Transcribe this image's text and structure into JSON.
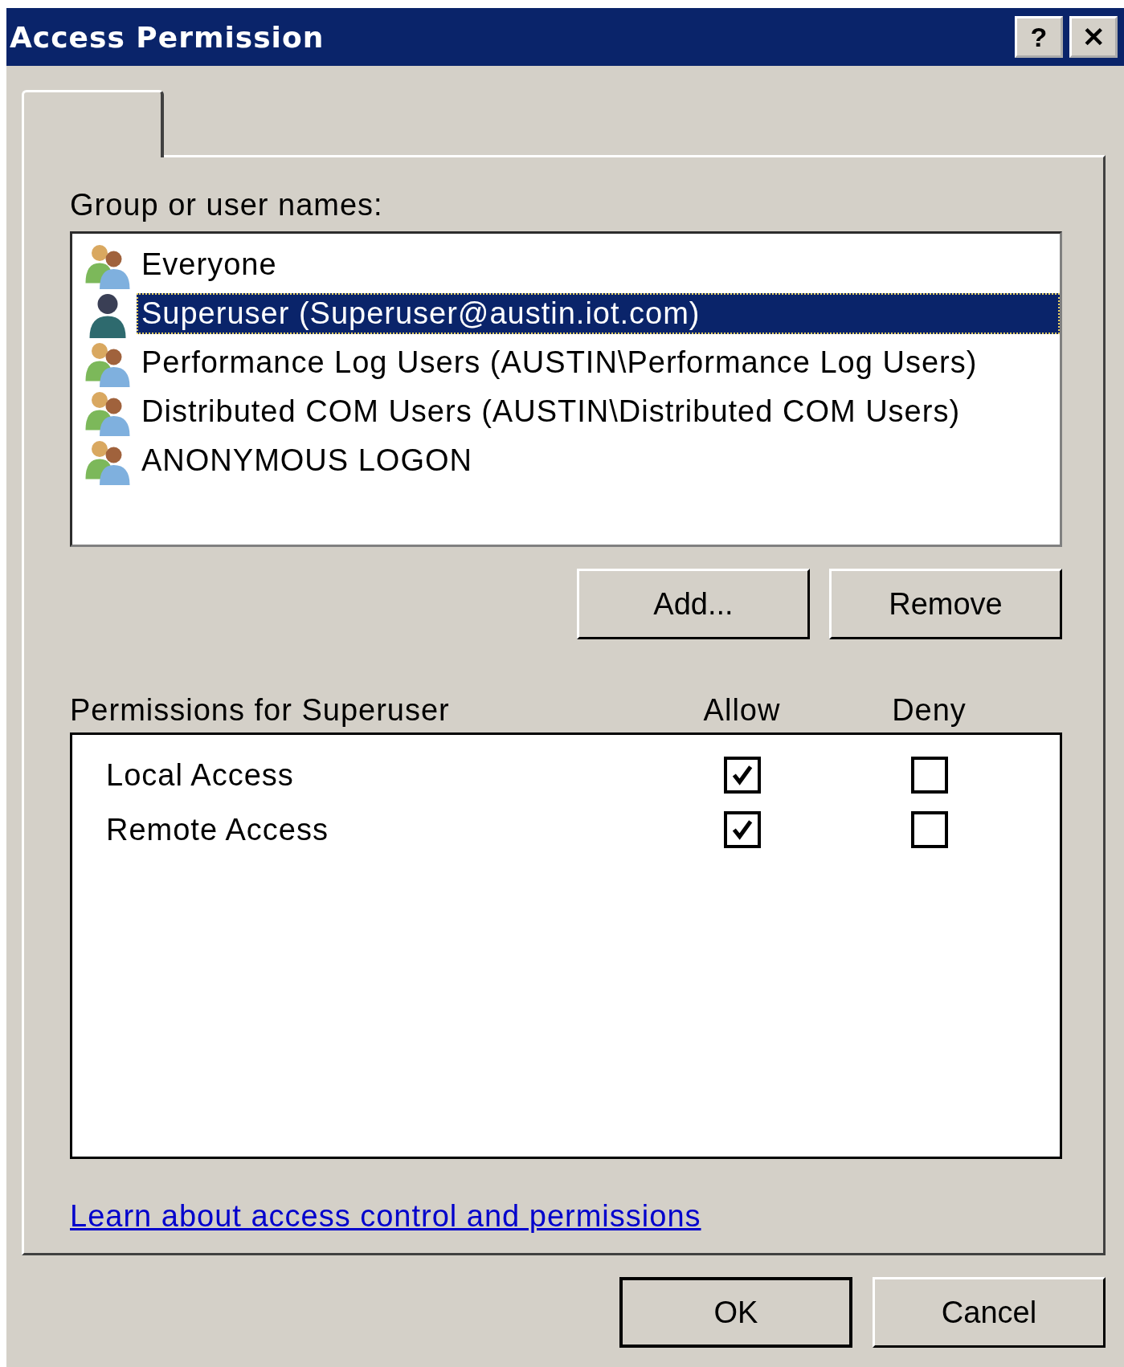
{
  "window": {
    "title": "Access Permission",
    "title_buttons": [
      "?",
      "✕"
    ]
  },
  "group_label": "Group or user names:",
  "users": [
    {
      "name": "Everyone",
      "kind": "group",
      "selected": false
    },
    {
      "name": "Superuser (Superuser@austin.iot.com)",
      "kind": "user",
      "selected": true
    },
    {
      "name": "Performance Log Users (AUSTIN\\Performance Log Users)",
      "kind": "group",
      "selected": false
    },
    {
      "name": "Distributed COM Users (AUSTIN\\Distributed COM Users)",
      "kind": "group",
      "selected": false
    },
    {
      "name": "ANONYMOUS LOGON",
      "kind": "group",
      "selected": false
    }
  ],
  "user_buttons": [
    "Add...",
    "Remove"
  ],
  "permissions_label": "Permissions for Superuser",
  "columns": [
    "Allow",
    "Deny"
  ],
  "permissions": [
    {
      "name": "Local Access",
      "allow": true,
      "deny": false
    },
    {
      "name": "Remote Access",
      "allow": true,
      "deny": false
    }
  ],
  "link": "Learn about access control and permissions",
  "buttons": [
    {
      "label": "OK",
      "default": true
    },
    {
      "label": "Cancel",
      "default": false
    }
  ]
}
